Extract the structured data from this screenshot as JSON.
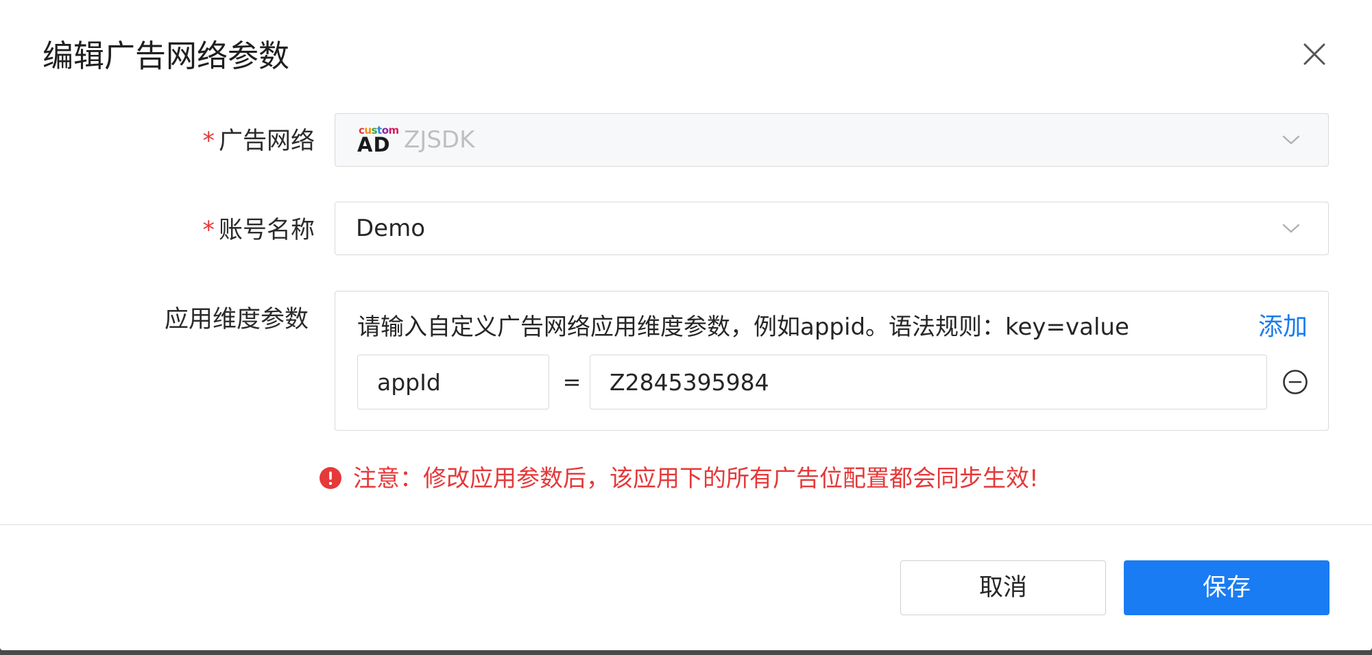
{
  "dialog": {
    "title": "编辑广告网络参数"
  },
  "form": {
    "ad_network": {
      "label": "广告网络",
      "required_mark": "*",
      "value": "ZJSDK",
      "logo": {
        "top_text": "custom",
        "bottom_text": "AD"
      },
      "icon": "chevron-down-icon"
    },
    "account_name": {
      "label": "账号名称",
      "required_mark": "*",
      "value": "Demo",
      "icon": "chevron-down-icon"
    },
    "app_params": {
      "label": "应用维度参数",
      "hint": "请输入自定义广告网络应用维度参数，例如appid。语法规则：key=value",
      "add_label": "添加",
      "rows": [
        {
          "key": "appId",
          "separator": "=",
          "value": "Z2845395984"
        }
      ]
    }
  },
  "warning": {
    "text": "注意：修改应用参数后，该应用下的所有广告位配置都会同步生效!",
    "color": "#e5393a"
  },
  "footer": {
    "cancel_label": "取消",
    "save_label": "保存"
  },
  "colors": {
    "primary": "#1a7cf2",
    "danger": "#e5393a",
    "border": "#d9d9d9"
  }
}
